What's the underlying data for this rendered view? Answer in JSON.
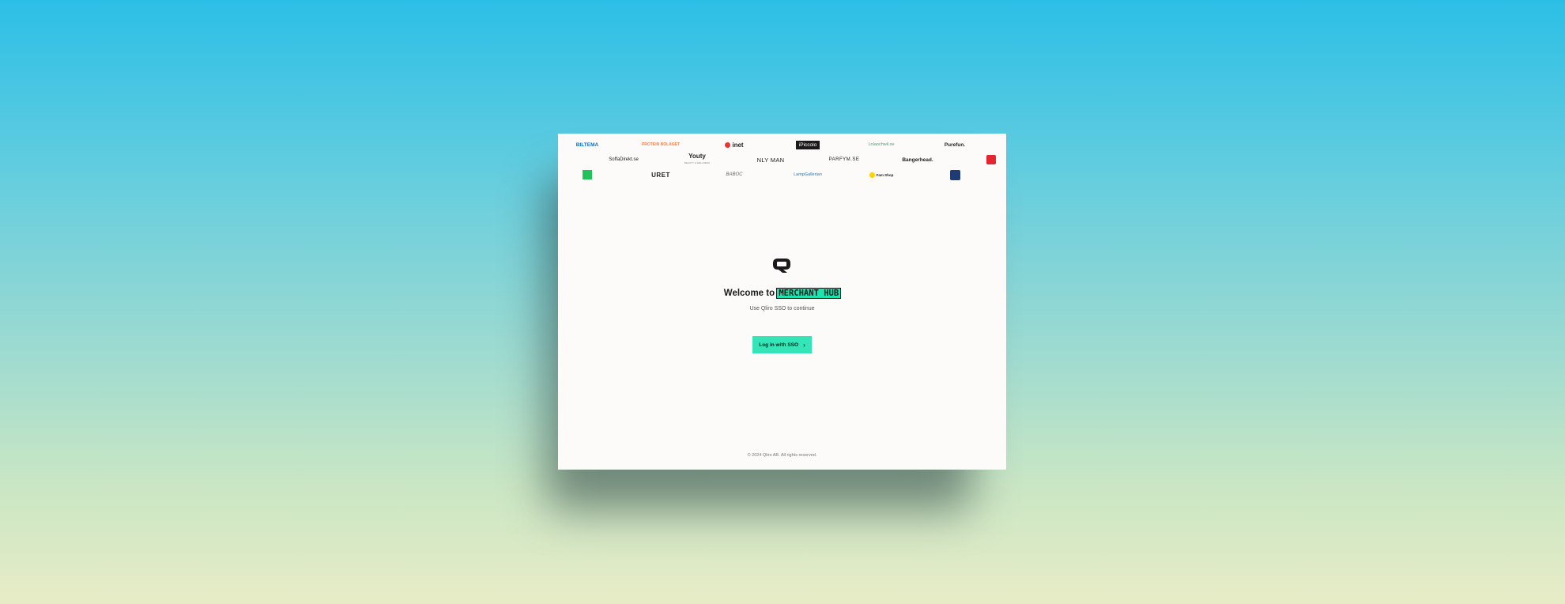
{
  "logos": {
    "row1": [
      "BILTEMA",
      "PROTEIN BOLAGET",
      "inet",
      "iPiccolo",
      "Lolaochwil.se",
      "Purefun."
    ],
    "row2": [
      "SoffaDirekt.se",
      "Youty",
      "NLY MAN",
      "PARFYM.SE",
      "Bangerhead.",
      "red-logo"
    ],
    "row2_youty_tagline": "BEAUTY & WELLNESS",
    "row3": [
      "green-logo",
      "URET",
      "BABOC",
      "LampGallerian",
      "Fam Shop",
      "navy-logo"
    ]
  },
  "welcome": {
    "prefix": "Welcome to",
    "highlight": "MERCHANT HUB",
    "subtitle": "Use Qliro SSO to continue"
  },
  "sso_button_label": "Log in with SSO",
  "sso_button_icon": "chevron-right-icon",
  "footer": "© 2024 Qliro AB. All rights reserved.",
  "colors": {
    "accent": "#35e5b8",
    "highlight": "#1ee2b0"
  }
}
